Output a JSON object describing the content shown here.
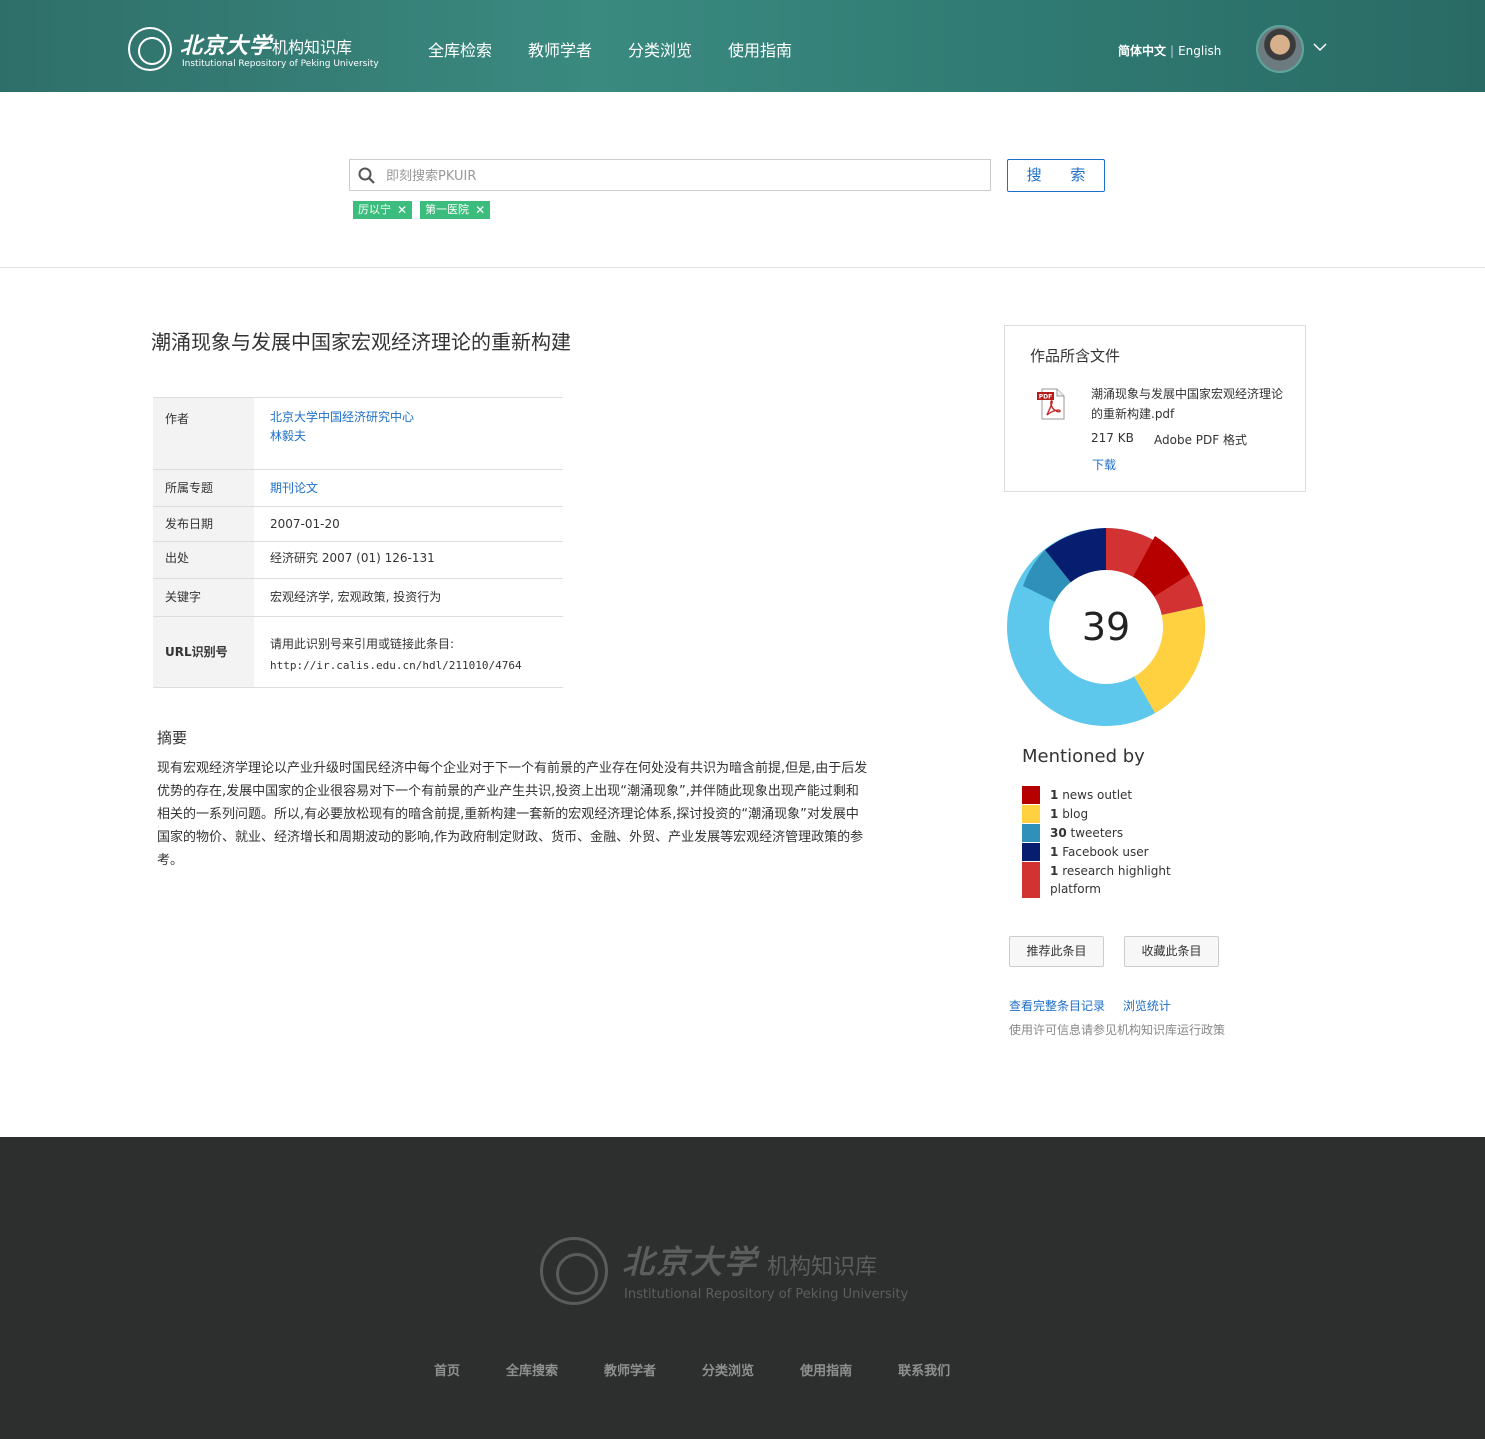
{
  "header": {
    "logo_cn": "北京大学",
    "logo_sub": "机构知识库",
    "logo_en": "Institutional Repository of Peking University",
    "nav": [
      "全库检索",
      "教师学者",
      "分类浏览",
      "使用指南"
    ],
    "lang_current": "简体中文",
    "lang_other": "English"
  },
  "search": {
    "placeholder": "即刻搜索PKUIR",
    "button": "搜 索",
    "tags": [
      "厉以宁",
      "第一医院"
    ]
  },
  "item": {
    "title": "潮涌现象与发展中国家宏观经济理论的重新构建",
    "meta": {
      "author_label": "作者",
      "authors": [
        "北京大学中国经济研究中心",
        "林毅夫"
      ],
      "topic_label": "所属专题",
      "topic": "期刊论文",
      "date_label": "发布日期",
      "date": "2007-01-20",
      "source_label": "出处",
      "source": "经济研究 2007 (01) 126-131",
      "keywords_label": "关键字",
      "keywords": "宏观经济学, 宏观政策, 投资行为",
      "url_label": "URL识别号",
      "url_hint": "请用此识别号来引用或链接此条目:",
      "url": "http://ir.calis.edu.cn/hdl/211010/4764"
    },
    "abstract_title": "摘要",
    "abstract": "现有宏观经济学理论以产业升级时国民经济中每个企业对于下一个有前景的产业存在何处没有共识为暗含前提,但是,由于后发优势的存在,发展中国家的企业很容易对下一个有前景的产业产生共识,投资上出现“潮涌现象”,并伴随此现象出现产能过剩和相关的一系列问题。所以,有必要放松现有的暗含前提,重新构建一套新的宏观经济理论体系,探讨投资的“潮涌现象”对发展中国家的物价、就业、经济增长和周期波动的影响,作为政府制定财政、货币、金融、外贸、产业发展等宏观经济管理政策的参考。"
  },
  "files": {
    "title": "作品所含文件",
    "name": "潮涌现象与发展中国家宏观经济理论的重新构建.pdf",
    "size": "217 KB",
    "format": "Adobe PDF 格式",
    "download": "下载"
  },
  "altmetric": {
    "score": "39",
    "mentioned_by": "Mentioned by",
    "mentions": [
      {
        "count": "1",
        "label": "news outlet",
        "color": "#b60000"
      },
      {
        "count": "1",
        "label": "blog",
        "color": "#ffd140"
      },
      {
        "count": "30",
        "label": "tweeters",
        "color": "#2f90b9"
      },
      {
        "count": "1",
        "label": "Facebook user",
        "color": "#071d70"
      },
      {
        "count": "1",
        "label": "research highlight platform",
        "color": "#d33233"
      }
    ]
  },
  "actions": {
    "recommend": "推荐此条目",
    "favorite": "收藏此条目",
    "full_record": "查看完整条目记录",
    "stats": "浏览统计",
    "policy": "使用许可信息请参见机构知识库运行政策"
  },
  "footer": {
    "logo_cn": "北京大学",
    "logo_sub": "机构知识库",
    "logo_en": "Institutional Repository of Peking University",
    "nav": [
      "首页",
      "全库搜索",
      "教师学者",
      "分类浏览",
      "使用指南",
      "联系我们"
    ]
  }
}
